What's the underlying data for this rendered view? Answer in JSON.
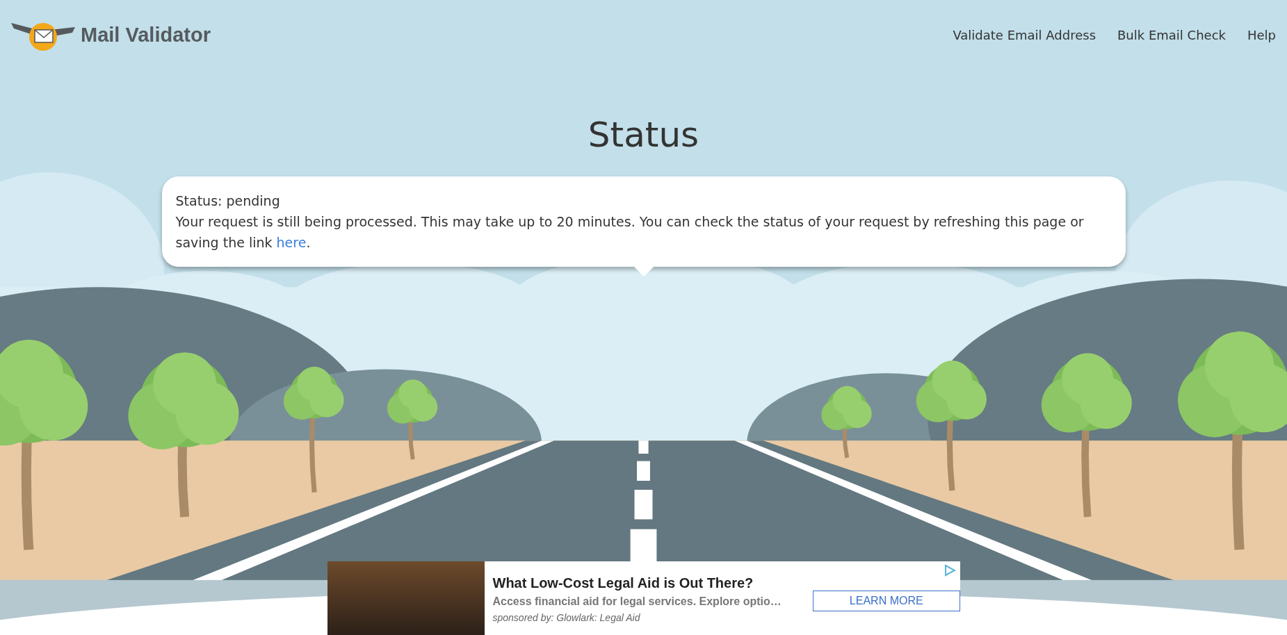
{
  "header": {
    "logo_text": "Mail Validator",
    "nav": [
      "Validate Email Address",
      "Bulk Email Check",
      "Help"
    ]
  },
  "title": "Status",
  "message": {
    "status_line": "Status: pending",
    "text": "Your request is still being processed. This may take up to 20 minutes. You can check the status of your request by refreshing this page or saving the link ",
    "link": "here",
    "after": "."
  },
  "ad": {
    "headline": "What Low-Cost Legal Aid is Out There?",
    "description": "Access financial aid for legal services. Explore optio…",
    "sponsor": "sponsored by: Glowlark: Legal Aid",
    "button": "LEARN MORE"
  }
}
